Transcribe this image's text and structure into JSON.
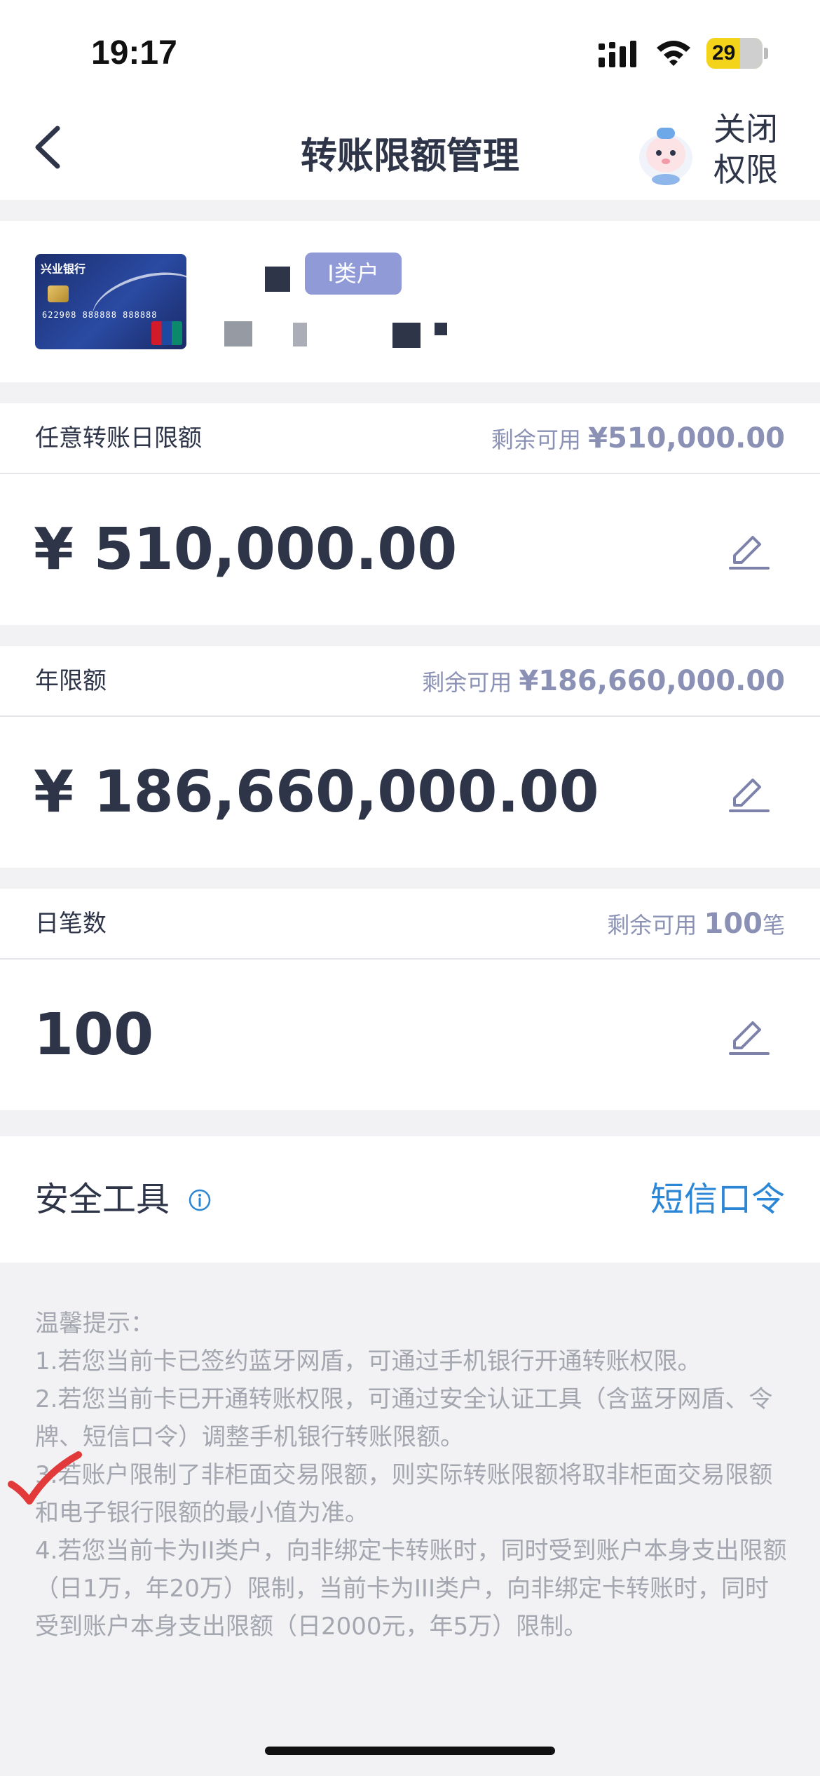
{
  "status_bar": {
    "time": "19:17",
    "battery": "29"
  },
  "nav": {
    "title": "转账限额管理",
    "close_permission": "关闭权限"
  },
  "account": {
    "card_bank_name": "兴业银行",
    "card_number_preview": "622908 888888 888888",
    "account_type_badge": "I类户"
  },
  "limits": [
    {
      "label": "任意转账日限额",
      "remaining_prefix": "剩余可用 ",
      "remaining_value": "¥510,000.00",
      "remaining_suffix": "",
      "amount": "¥ 510,000.00"
    },
    {
      "label": "年限额",
      "remaining_prefix": "剩余可用 ",
      "remaining_value": "¥186,660,000.00",
      "remaining_suffix": "",
      "amount": "¥ 186,660,000.00"
    },
    {
      "label": "日笔数",
      "remaining_prefix": "剩余可用 ",
      "remaining_value": "100",
      "remaining_suffix": "笔",
      "amount": "100"
    }
  ],
  "security_tool": {
    "label": "安全工具",
    "value": "短信口令"
  },
  "tips": [
    "温馨提示：",
    "1.若您当前卡已签约蓝牙网盾，可通过手机银行开通转账权限。",
    "2.若您当前卡已开通转账权限，可通过安全认证工具（含蓝牙网盾、令牌、短信口令）调整手机银行转账限额。",
    "3.若账户限制了非柜面交易限额，则实际转账限额将取非柜面交易限额和电子银行限额的最小值为准。",
    "4.若您当前卡为II类户，向非绑定卡转账时，同时受到账户本身支出限额（日1万，年20万）限制，当前卡为III类户，向非绑定卡转账时，同时受到账户本身支出限额（日2000元，年5万）限制。"
  ],
  "colors": {
    "accent_blue": "#2b86d6",
    "badge": "#8f9ad6",
    "text_dark": "#2e3548",
    "muted": "#8a91b4"
  }
}
